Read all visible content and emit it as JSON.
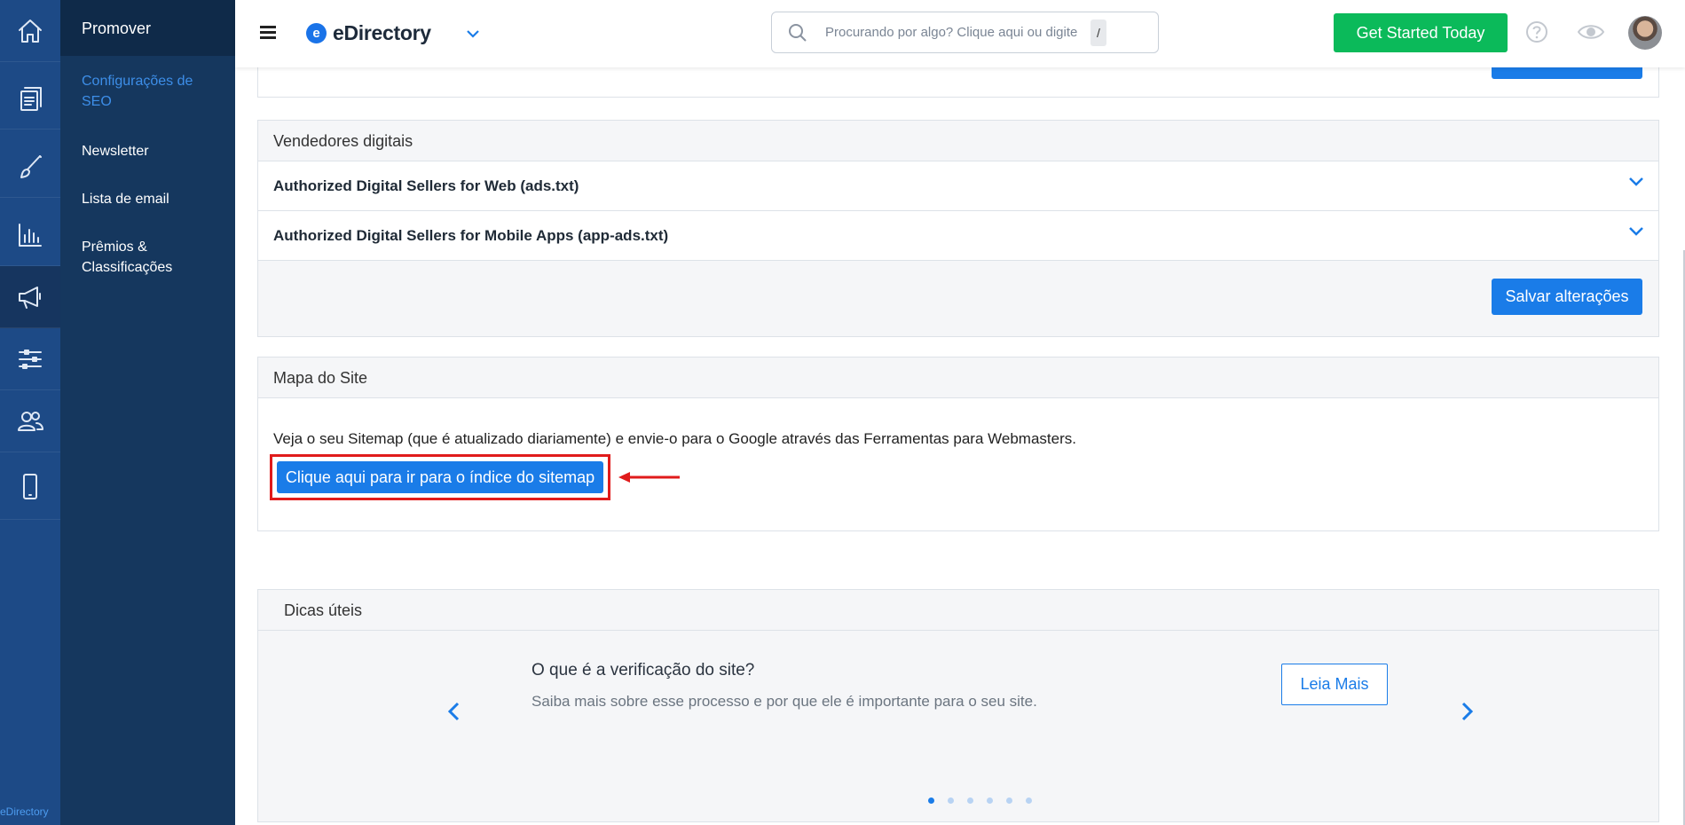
{
  "rail": {
    "brand": "eDirectory",
    "icons": [
      "home-icon",
      "content-icon",
      "design-icon",
      "reports-icon",
      "promote-icon",
      "settings-icon",
      "users-icon",
      "mobile-icon"
    ]
  },
  "sidebar": {
    "title": "Promover",
    "items": [
      {
        "label": "Configurações de SEO",
        "active": true
      },
      {
        "label": "Newsletter"
      },
      {
        "label": "Lista de email"
      },
      {
        "label": "Prêmios & Classificações"
      }
    ]
  },
  "header": {
    "logo_letter": "e",
    "logo_text": "eDirectory",
    "search_placeholder": "Procurando por algo? Clique aqui ou digite",
    "search_shortcut": "/",
    "cta_label": "Get Started Today"
  },
  "digital_sellers": {
    "title": "Vendedores digitais",
    "rows": [
      {
        "label": "Authorized Digital Sellers for Web (ads.txt)"
      },
      {
        "label": "Authorized Digital Sellers for Mobile Apps (app-ads.txt)"
      }
    ],
    "save_label": "Salvar alterações"
  },
  "sitemap": {
    "title": "Mapa do Site",
    "description": "Veja o seu Sitemap (que é atualizado diariamente) e envie-o para o Google através das Ferramentas para Webmasters.",
    "button_label": "Clique aqui para ir para o índice do sitemap"
  },
  "tips": {
    "title": "Dicas úteis",
    "heading": "O que é a verificação do site?",
    "text": "Saiba mais sobre esse processo e por que ele é importante para o seu site.",
    "read_more_label": "Leia Mais",
    "page_count": 6,
    "active_page": 1
  },
  "colors": {
    "accent": "#1a7ce8",
    "cta": "#0bba5a",
    "highlight": "#e01b1b",
    "rail": "#1d4a86",
    "sidebar": "#15375e"
  }
}
